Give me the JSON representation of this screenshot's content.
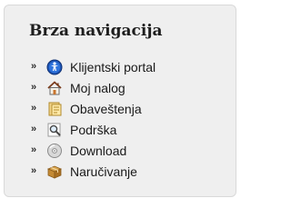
{
  "panel": {
    "title": "Brza navigacija",
    "arrow": "»",
    "items": [
      {
        "label": "Klijentski portal",
        "icon": "portal-globe-icon"
      },
      {
        "label": "Moj nalog",
        "icon": "home-icon"
      },
      {
        "label": "Obaveštenja",
        "icon": "notes-icon"
      },
      {
        "label": "Podrška",
        "icon": "magnifier-icon"
      },
      {
        "label": "Download",
        "icon": "disc-icon"
      },
      {
        "label": "Naručivanje",
        "icon": "package-icon"
      }
    ]
  }
}
